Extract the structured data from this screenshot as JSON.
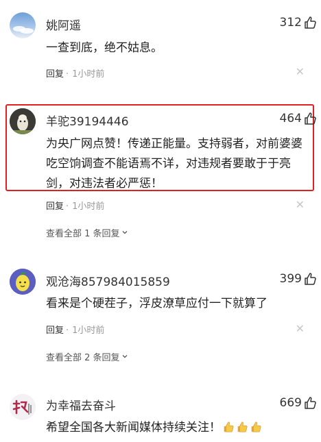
{
  "comments": [
    {
      "username": "姚阿遥",
      "likes": "312",
      "text": "一查到底，绝不姑息。",
      "reply_label": "回复",
      "time": "1小时前"
    },
    {
      "username": "羊驼39194446",
      "likes": "464",
      "text": "为央广网点赞！传递正能量。支持弱者，对前婆婆吃空饷调查不能语焉不详，对违规者要敢于于亮剑，对违法者必严惩！",
      "reply_label": "回复",
      "time": "1小时前",
      "view_replies": "查看全部 1 条回复"
    },
    {
      "username": "观沧海857984015859",
      "likes": "399",
      "text": "看来是个硬茬子，浮皮潦草应付一下就算了",
      "reply_label": "回复",
      "time": "1小时前",
      "view_replies": "查看全部 2 条回复"
    },
    {
      "username": "为幸福去奋斗",
      "likes": "669",
      "text": "希望全国各大新闻媒体持续关注！",
      "emojis": [
        "thumbs-up",
        "thumbs-up",
        "thumbs-up"
      ]
    }
  ],
  "colors": {
    "highlight": "#e02020",
    "muted": "#999999"
  }
}
